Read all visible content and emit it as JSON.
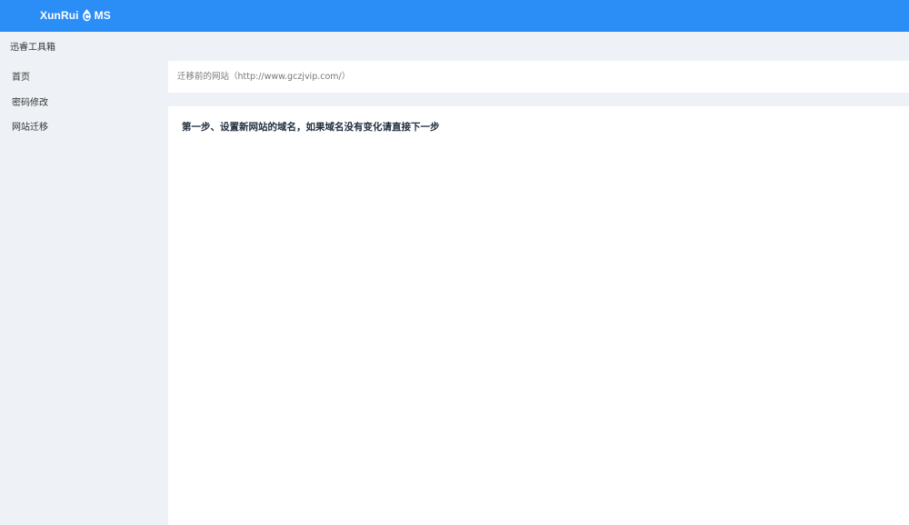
{
  "header": {
    "logo_prefix": "XunRui",
    "logo_suffix": "MS",
    "logo_icon": "flame-drop-c-icon",
    "accent_color": "#2b8ef7"
  },
  "app": {
    "title": "迅睿工具箱"
  },
  "sidebar": {
    "items": [
      {
        "label": "首页"
      },
      {
        "label": "密码修改"
      },
      {
        "label": "网站迁移"
      }
    ]
  },
  "migration": {
    "source_site_label": "迁移前的网站（http://www.gczjvip.com/）",
    "step_text": "第一步、设置新网站的域名，如果域名没有变化请直接下一步"
  }
}
